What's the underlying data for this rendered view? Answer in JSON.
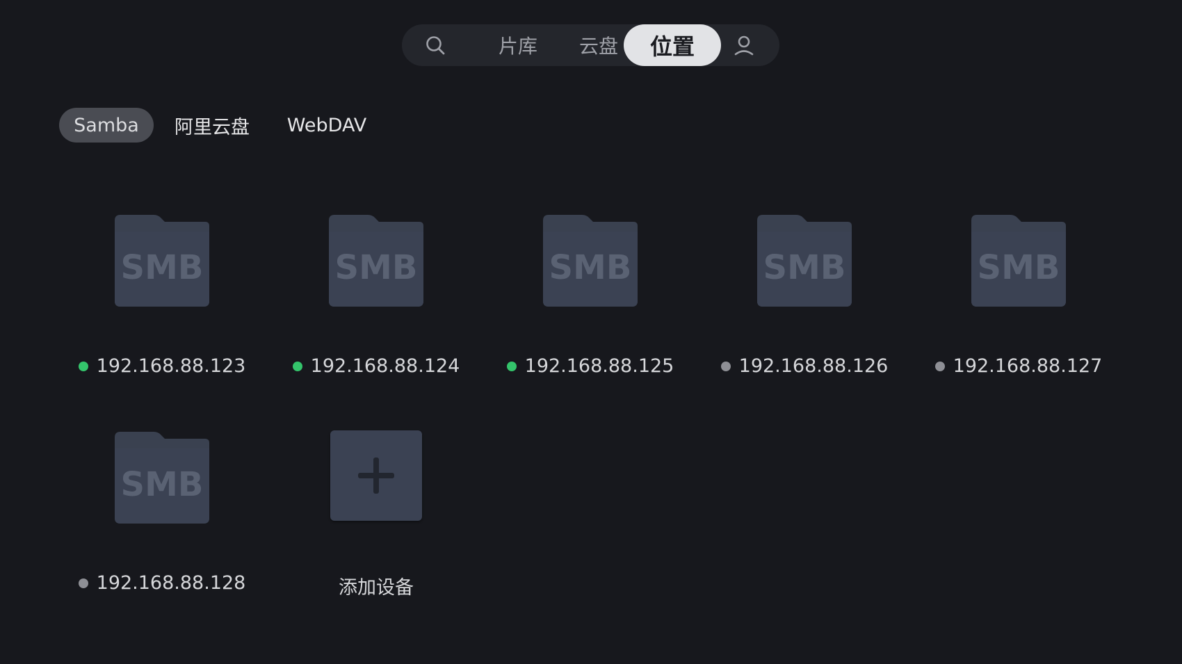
{
  "nav": {
    "library": "片库",
    "cloud": "云盘",
    "location": "位置"
  },
  "subtabs": {
    "samba": "Samba",
    "aliyun": "阿里云盘",
    "webdav": "WebDAV"
  },
  "colors": {
    "online": "#34c46b",
    "offline": "#8e8f95"
  },
  "folder_label": "SMB",
  "devices": [
    {
      "ip": "192.168.88.123",
      "status": "online"
    },
    {
      "ip": "192.168.88.124",
      "status": "online"
    },
    {
      "ip": "192.168.88.125",
      "status": "online"
    },
    {
      "ip": "192.168.88.126",
      "status": "offline"
    },
    {
      "ip": "192.168.88.127",
      "status": "offline"
    },
    {
      "ip": "192.168.88.128",
      "status": "offline"
    }
  ],
  "add_device": {
    "label": "添加设备"
  }
}
